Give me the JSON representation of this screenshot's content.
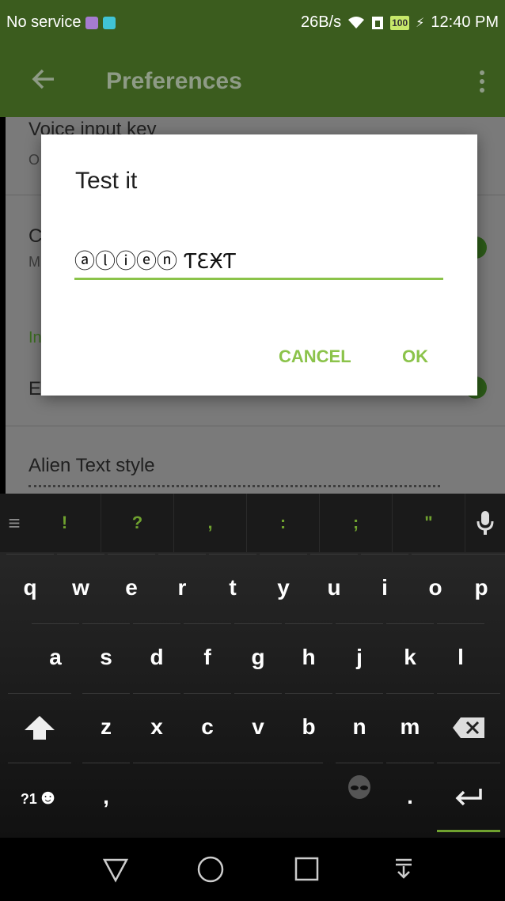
{
  "status_bar": {
    "carrier": "No service",
    "speed": "26B/s",
    "battery": "100",
    "time": "12:40 PM",
    "colors": {
      "bg": "#3b5c1e",
      "icon1": "#a67cd1",
      "icon2": "#40c4d6"
    }
  },
  "toolbar": {
    "title": "Preferences",
    "back_icon": "arrow-left-icon",
    "more_icon": "more-vert-icon"
  },
  "preferences": {
    "voice_input_title": "Voice input key",
    "voice_input_sub": "O",
    "item2_title": "C",
    "item2_sub": "M",
    "category": "In",
    "alien_toggle_title": "E",
    "alien_style_title": "Alien Text style"
  },
  "dialog": {
    "title": "Test it",
    "input_value": "ⓐⓛⓘⓔⓝ ƬƐӾƬ",
    "cancel_label": "CANCEL",
    "ok_label": "OK",
    "accent": "#8bc34a"
  },
  "keyboard": {
    "suggestions": [
      "!",
      "?",
      ",",
      ":",
      ";",
      "\""
    ],
    "row1": [
      "q",
      "w",
      "e",
      "r",
      "t",
      "y",
      "u",
      "i",
      "o",
      "p"
    ],
    "row2": [
      "a",
      "s",
      "d",
      "f",
      "g",
      "h",
      "j",
      "k",
      "l"
    ],
    "row3": [
      "z",
      "x",
      "c",
      "v",
      "b",
      "n",
      "m"
    ],
    "symbols_label": "?1",
    "comma": ",",
    "period": ".",
    "accent": "#6fa12f"
  },
  "navbar": {
    "back_icon": "triangle-back-icon",
    "home_icon": "circle-home-icon",
    "recents_icon": "square-recents-icon",
    "hide_keyboard_icon": "hide-keyboard-icon"
  }
}
